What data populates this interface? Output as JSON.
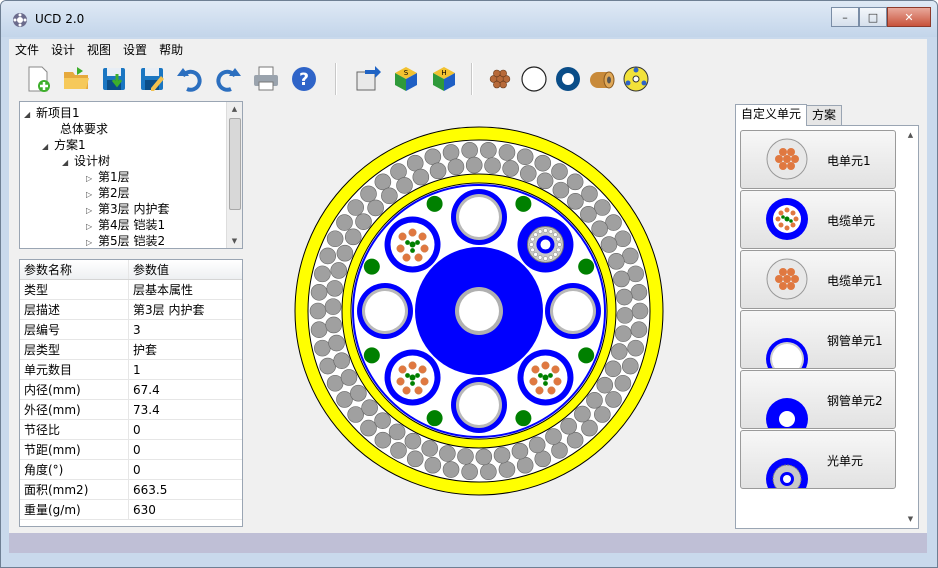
{
  "window": {
    "title": "UCD 2.0",
    "icon": "app-gear-icon"
  },
  "window_controls": {
    "minimize": "–",
    "maximize": "□",
    "close": "✕"
  },
  "menu": [
    "文件",
    "设计",
    "视图",
    "设置",
    "帮助"
  ],
  "toolbar": {
    "groups": [
      [
        "new-file-icon",
        "open-folder-icon",
        "save-icon",
        "save-as-icon",
        "undo-icon",
        "redo-icon",
        "print-icon",
        "help-icon"
      ],
      [
        "export-icon",
        "cube-s-icon",
        "cube-h-icon"
      ],
      [
        "stranded-core-icon",
        "ring-icon",
        "tube-icon",
        "armor-icon",
        "fiber-icon"
      ]
    ]
  },
  "tree": {
    "items": [
      {
        "label": "新项目1",
        "level": 0,
        "expanded": true
      },
      {
        "label": "总体要求",
        "level": 1
      },
      {
        "label": "方案1",
        "level": 1,
        "expanded": true
      },
      {
        "label": "设计树",
        "level": 2,
        "expanded": true
      },
      {
        "label": "第1层",
        "level": 3,
        "collapsed": true
      },
      {
        "label": "第2层",
        "level": 3,
        "collapsed": true
      },
      {
        "label": "第3层 内护套",
        "level": 3,
        "collapsed": true
      },
      {
        "label": "第4层 铠装1",
        "level": 3,
        "collapsed": true
      },
      {
        "label": "第5层 铠装2",
        "level": 3,
        "collapsed": true
      }
    ]
  },
  "properties": {
    "headers": [
      "参数名称",
      "参数值"
    ],
    "rows": [
      [
        "类型",
        "层基本属性"
      ],
      [
        "层描述",
        "第3层 内护套"
      ],
      [
        "层编号",
        "3"
      ],
      [
        "层类型",
        "护套"
      ],
      [
        "单元数目",
        "1"
      ],
      [
        "内径(mm)",
        "67.4"
      ],
      [
        "外径(mm)",
        "73.4"
      ],
      [
        "节径比",
        "0"
      ],
      [
        "节距(mm)",
        "0"
      ],
      [
        "角度(°)",
        "0"
      ],
      [
        "面积(mm2)",
        "663.5"
      ],
      [
        "重量(g/m)",
        "630"
      ]
    ]
  },
  "right_panel": {
    "tabs": [
      "自定义单元",
      "方案"
    ],
    "active_tab": 0,
    "units": [
      "电单元1",
      "电缆单元",
      "电缆单元1",
      "钢管单元1",
      "钢管单元2",
      "光单元"
    ]
  },
  "colors": {
    "jacket_yellow": "#ffff00",
    "armor_grey": "#a0a0a0",
    "core_blue": "#0000ff",
    "filler_green": "#008000",
    "copper_orange": "#e07840",
    "statusbar": "#bfbfd6"
  }
}
